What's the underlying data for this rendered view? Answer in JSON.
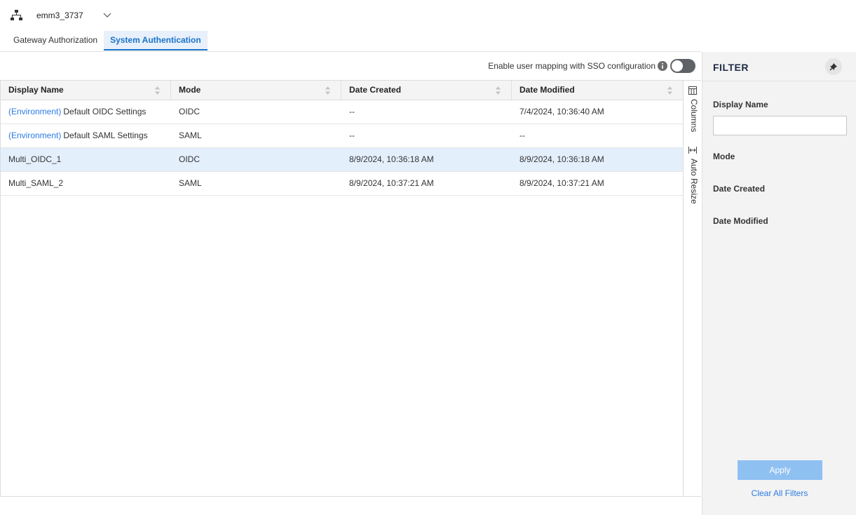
{
  "environment": {
    "name": "emm3_3737"
  },
  "tabs": [
    {
      "label": "Gateway Authorization",
      "active": false
    },
    {
      "label": "System Authentication",
      "active": true
    }
  ],
  "sso_toggle": {
    "label": "Enable user mapping with SSO configuration",
    "enabled": false
  },
  "table": {
    "columns": [
      "Display Name",
      "Mode",
      "Date Created",
      "Date Modified"
    ],
    "rows": [
      {
        "tag": "(Environment)",
        "name": "Default OIDC Settings",
        "mode": "OIDC",
        "created": "--",
        "modified": "7/4/2024, 10:36:40 AM",
        "selected": false
      },
      {
        "tag": "(Environment)",
        "name": "Default SAML Settings",
        "mode": "SAML",
        "created": "--",
        "modified": "--",
        "selected": false
      },
      {
        "tag": "",
        "name": "Multi_OIDC_1",
        "mode": "OIDC",
        "created": "8/9/2024, 10:36:18 AM",
        "modified": "8/9/2024, 10:36:18 AM",
        "selected": true
      },
      {
        "tag": "",
        "name": "Multi_SAML_2",
        "mode": "SAML",
        "created": "8/9/2024, 10:37:21 AM",
        "modified": "8/9/2024, 10:37:21 AM",
        "selected": false
      }
    ]
  },
  "side_tools": {
    "columns_label": "Columns",
    "auto_resize_label": "Auto Resize"
  },
  "filter": {
    "title": "FILTER",
    "display_name_label": "Display Name",
    "display_name_value": "",
    "mode_label": "Mode",
    "date_created_label": "Date Created",
    "date_modified_label": "Date Modified",
    "apply_label": "Apply",
    "clear_label": "Clear All Filters"
  },
  "colors": {
    "accent": "#2c7be5",
    "selected_row": "#e4effc",
    "apply_disabled": "#8fc0f2",
    "toggle_off": "#5f6368"
  }
}
